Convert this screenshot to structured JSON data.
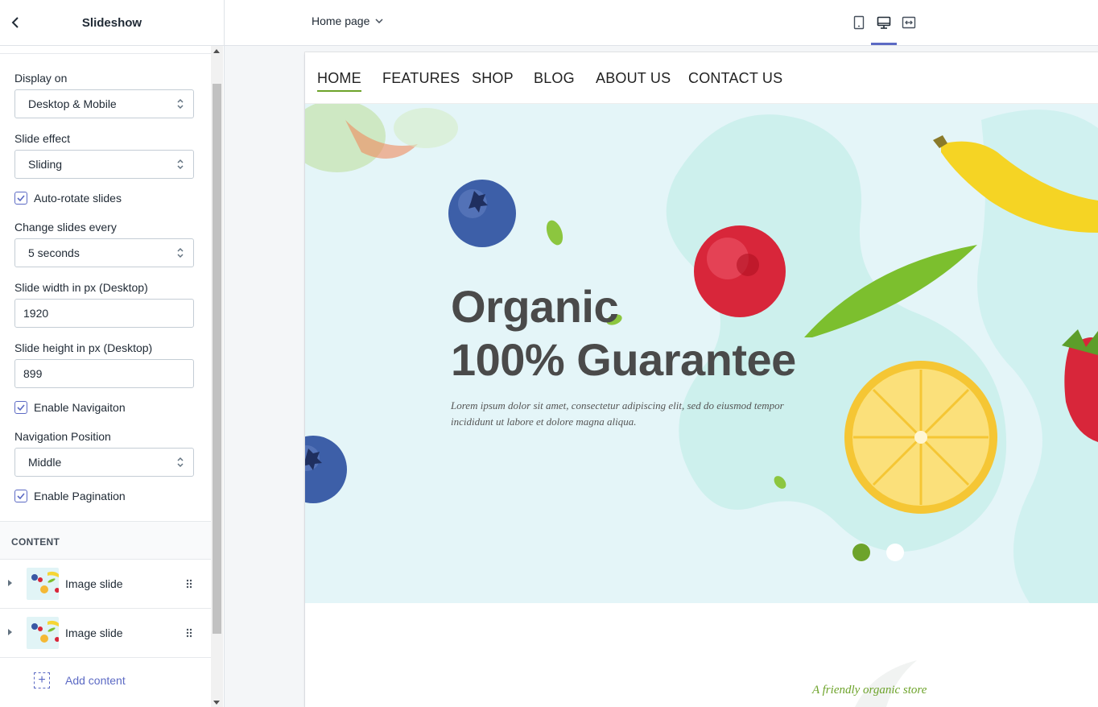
{
  "sidebar": {
    "title": "Slideshow",
    "fields": {
      "display_on": {
        "label": "Display on",
        "value": "Desktop & Mobile"
      },
      "slide_effect": {
        "label": "Slide effect",
        "value": "Sliding"
      },
      "auto_rotate": {
        "label": "Auto-rotate slides",
        "checked": true
      },
      "change_every": {
        "label": "Change slides every",
        "value": "5 seconds"
      },
      "slide_width": {
        "label": "Slide width in px (Desktop)",
        "value": "1920"
      },
      "slide_height": {
        "label": "Slide height in px (Desktop)",
        "value": "899"
      },
      "enable_navigation": {
        "label": "Enable Navigaiton",
        "checked": true
      },
      "nav_position": {
        "label": "Navigation Position",
        "value": "Middle"
      },
      "enable_pagination": {
        "label": "Enable Pagination",
        "checked": true
      }
    },
    "content_heading": "CONTENT",
    "content_items": [
      {
        "label": "Image slide"
      },
      {
        "label": "Image slide"
      }
    ],
    "add_content": "Add content"
  },
  "topbar": {
    "page_select": "Home page",
    "views": [
      "mobile-icon",
      "desktop-icon",
      "fullwidth-icon"
    ],
    "active_view": "desktop"
  },
  "preview": {
    "nav": [
      "HOME",
      "FEATURES",
      "SHOP",
      "BLOG",
      "ABOUT US",
      "CONTACT US"
    ],
    "hero": {
      "title_line1": "Organic",
      "title_line2": "100% Guarantee",
      "text": "Lorem ipsum dolor sit amet, consectetur adipiscing elit, sed do eiusmod tempor incididunt ut labore et dolore magna aliqua."
    },
    "pagination": {
      "total": 2,
      "active": 1
    },
    "tagline": "A friendly organic store"
  },
  "colors": {
    "accent": "#5c6ac4",
    "brand_green": "#6da32a",
    "hero_bg": "#e4f5f8",
    "title": "#4a4a4a"
  }
}
